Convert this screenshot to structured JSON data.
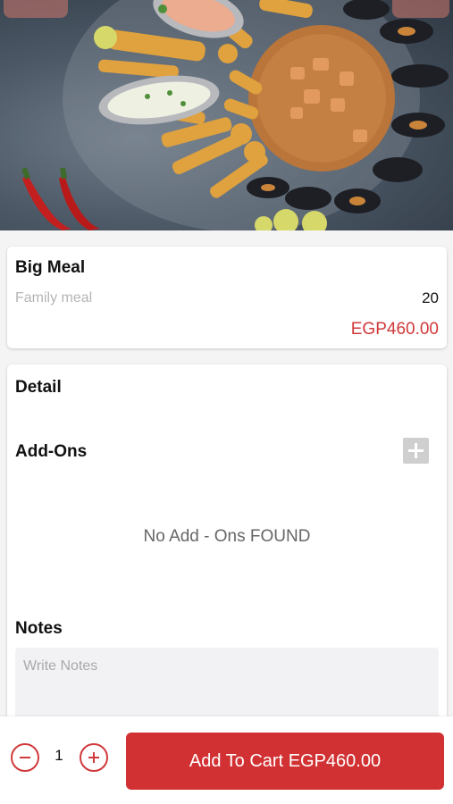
{
  "product": {
    "name": "Big Meal",
    "category": "Family meal",
    "count": "20",
    "price": "EGP460.00"
  },
  "detail": {
    "title": "Detail",
    "addons_title": "Add-Ons",
    "addons_empty": "No Add - Ons FOUND",
    "notes_title": "Notes",
    "notes_placeholder": "Write Notes"
  },
  "cart": {
    "quantity": "1",
    "add_label": "Add To Cart EGP460.00"
  },
  "colors": {
    "accent": "#d23133",
    "price": "#d0393b"
  }
}
